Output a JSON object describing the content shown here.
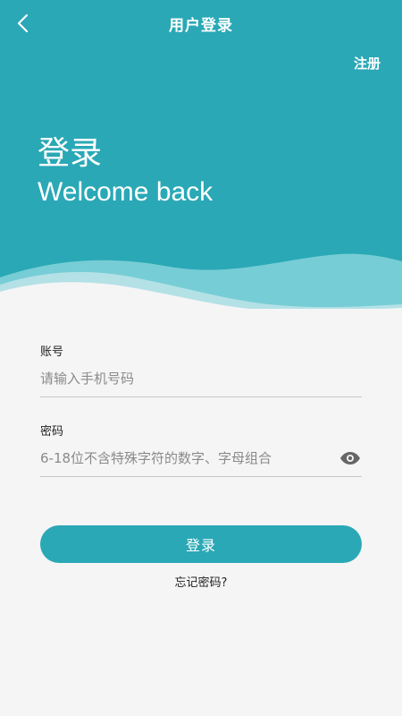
{
  "nav": {
    "title": "用户登录",
    "register_label": "注册"
  },
  "hero": {
    "title": "登录",
    "subtitle": "Welcome back"
  },
  "form": {
    "account": {
      "label": "账号",
      "placeholder": "请输入手机号码",
      "value": ""
    },
    "password": {
      "label": "密码",
      "placeholder": "6-18位不含特殊字符的数字、字母组合",
      "value": ""
    },
    "submit_label": "登录",
    "forgot_label": "忘记密码?"
  },
  "icons": {
    "back": "chevron-left-icon",
    "password_visibility": "eye-icon"
  },
  "colors": {
    "primary": "#2aa8b6",
    "wave_light": "#7fd0d8",
    "wave_mid": "#5bbfc9",
    "background": "#f5f5f5"
  }
}
